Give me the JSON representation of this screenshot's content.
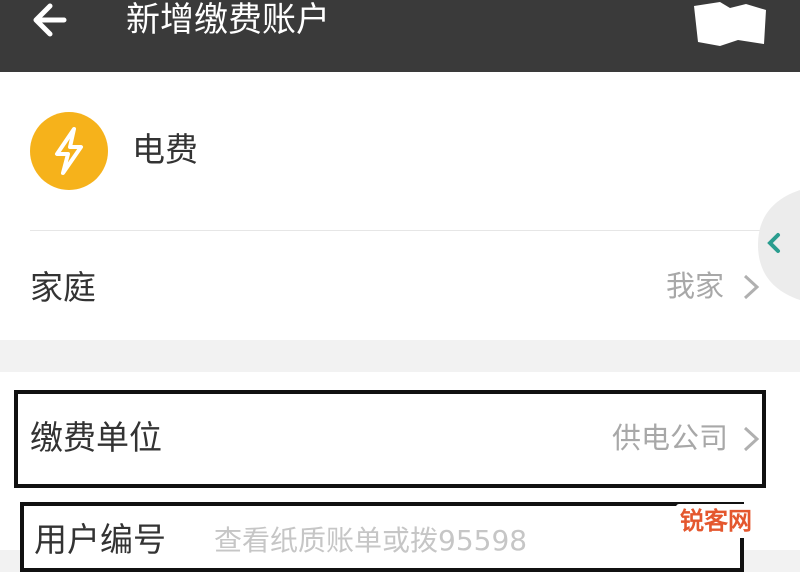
{
  "header": {
    "title": "新增缴费账户",
    "back_icon": "arrow-left-icon"
  },
  "bill": {
    "icon": "lightning-icon",
    "icon_color": "#f6b21b",
    "name": "电费"
  },
  "family": {
    "label": "家庭",
    "value": "我家"
  },
  "payment_unit": {
    "label": "缴费单位",
    "value": "供电公司"
  },
  "user_number": {
    "label": "用户编号",
    "placeholder": "查看纸质账单或拨95598"
  },
  "side_handle_icon": "chevron-left-icon",
  "watermark": {
    "text": "锐客网"
  }
}
